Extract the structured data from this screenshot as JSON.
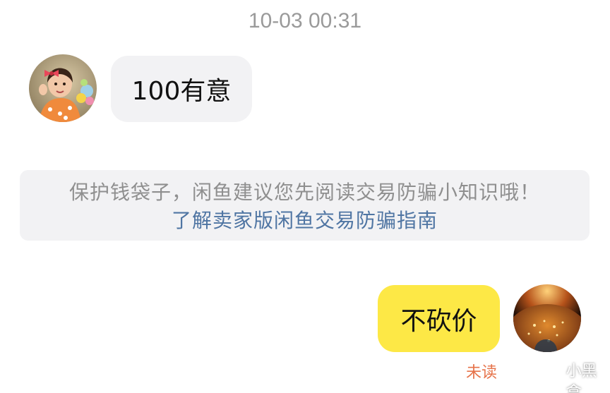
{
  "chat": {
    "timestamp": "10-03 00:31",
    "messages": [
      {
        "side": "left",
        "text": "100有意",
        "avatar": "child-photo-avatar"
      },
      {
        "side": "right",
        "text": "不砍价",
        "avatar": "earth-night-avatar",
        "status": "未读"
      }
    ],
    "notice": {
      "text": "保护钱袋子，闲鱼建议您先阅读交易防骗小知识哦！",
      "link": "了解卖家版闲鱼交易防骗指南"
    }
  },
  "watermark": {
    "text": "小黑盒",
    "icon": "xiaoheihe-logo-icon"
  },
  "colors": {
    "own_bubble": "#fde846",
    "other_bubble": "#f2f2f4",
    "link": "#4f75a3",
    "unread": "#e6734a",
    "timestamp": "#9a9a9a"
  }
}
